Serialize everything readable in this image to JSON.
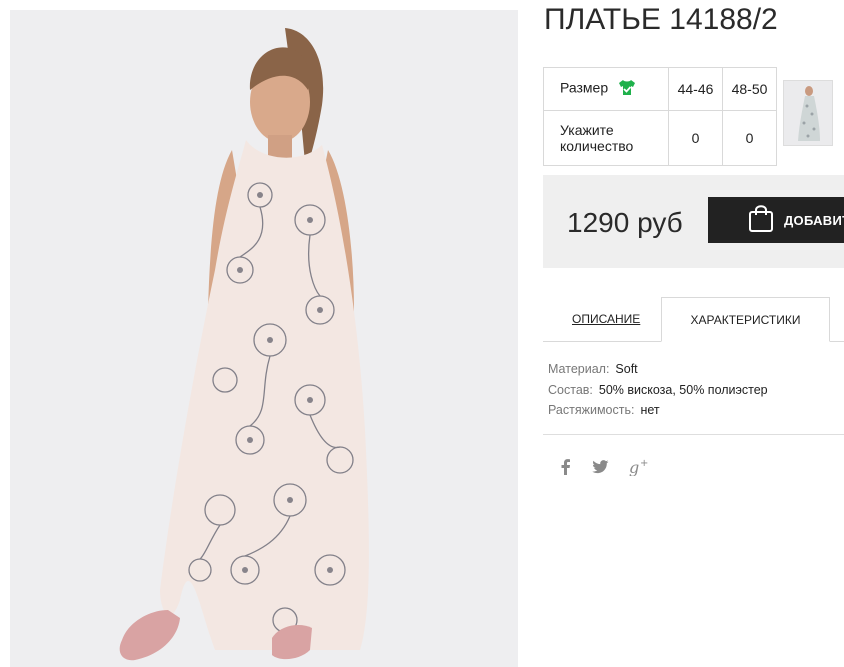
{
  "product": {
    "title": "ПЛАТЬЕ 14188/2"
  },
  "sizes": {
    "size_label": "Размер",
    "qty_label_line1": "Укажите",
    "qty_label_line2": "количество",
    "options": [
      "44-46",
      "48-50"
    ],
    "quantities": [
      "0",
      "0"
    ]
  },
  "buy": {
    "price": "1290 руб",
    "add_button_label": "ДОБАВИТ"
  },
  "tabs": {
    "description": "ОПИСАНИЕ",
    "characteristics": "ХАРАКТЕРИСТИКИ"
  },
  "characteristics": [
    {
      "key": "Материал:",
      "value": "Soft"
    },
    {
      "key": "Состав:",
      "value": "50% вискоза, 50% полиэстер"
    },
    {
      "key": "Растяжимость:",
      "value": "нет"
    }
  ],
  "social": {
    "icons": [
      "facebook-icon",
      "twitter-icon",
      "google-plus-icon"
    ],
    "google_plus_label": "g+"
  },
  "colors": {
    "accent_green": "#1fb14b",
    "button_dark": "#222222",
    "buybox_bg": "#efefef"
  }
}
